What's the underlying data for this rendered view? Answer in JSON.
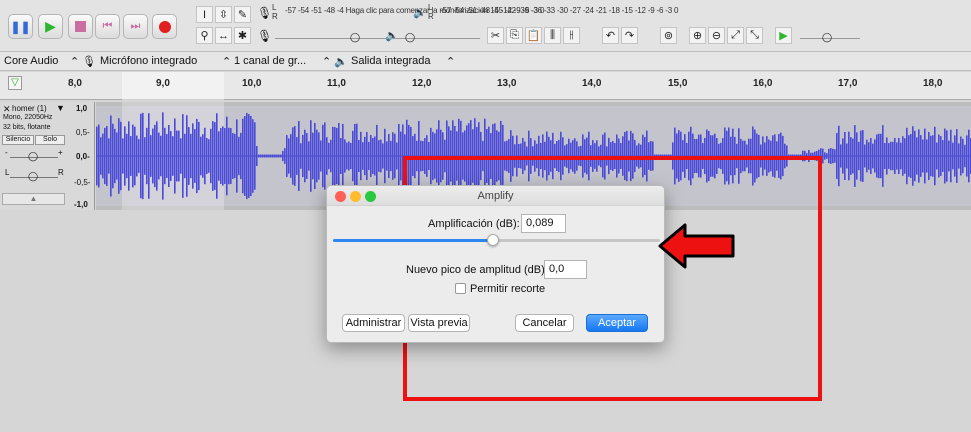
{
  "toolbar": {
    "transport": [
      "pause",
      "play",
      "stop",
      "skip-start",
      "skip-end",
      "record"
    ],
    "record_meter_text": "-57 -54 -51 -48 -4 Haga clic para comenzar la monitorización 15 -12 -9 -6 -3 0",
    "play_meter_text": "-57 -54 -51 -48 -45 -42 -39 -36 -33 -30 -27 -24 -21 -18 -15 -12 -9 -6 -3 0",
    "lr_l": "L",
    "lr_r": "R"
  },
  "devices": {
    "host": "Core Audio",
    "input": "Micrófono integrado",
    "channels": "1 canal de gr...",
    "output": "Salida integrada"
  },
  "ruler": {
    "labels": [
      "8,0",
      "9,0",
      "10,0",
      "11,0",
      "12,0",
      "13,0",
      "14,0",
      "15,0",
      "16,0",
      "17,0",
      "18,0"
    ]
  },
  "track": {
    "name": "homer (1)",
    "info1": "Mono, 22050Hz",
    "info2": "32 bits, flotante",
    "mute": "Silencio",
    "solo": "Solo",
    "gain_minus": "-",
    "gain_plus": "+",
    "pan_l": "L",
    "pan_r": "R",
    "scale": [
      "1,0",
      "0,5-",
      "0,0-",
      "-0,5-",
      "-1,0"
    ]
  },
  "dialog": {
    "title": "Amplify",
    "amp_label": "Amplificación (dB):",
    "amp_value": "0,089",
    "slider_position": 0.49,
    "peak_label": "Nuevo pico de amplitud (dB):",
    "peak_value": "0,0",
    "clip_label": "Permitir recorte",
    "manage": "Administrar",
    "preview": "Vista previa",
    "cancel": "Cancelar",
    "accept": "Aceptar"
  },
  "colors": {
    "accent": "#1677f1",
    "waveform": "#4a4ad8",
    "annotation": "#ee1111"
  }
}
